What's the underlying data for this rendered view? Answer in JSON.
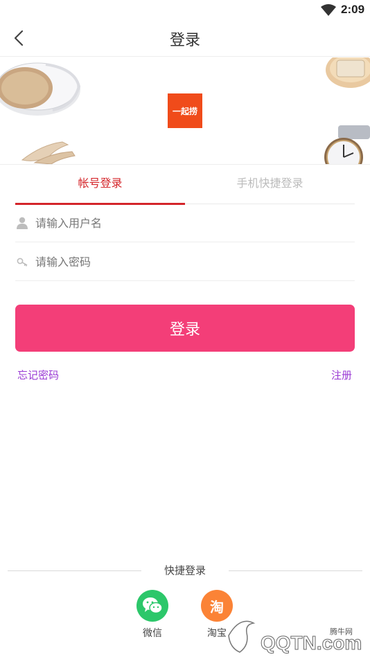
{
  "status_bar": {
    "time": "2:09"
  },
  "header": {
    "title": "登录"
  },
  "banner": {
    "logo_text": "一起捞"
  },
  "tabs": [
    {
      "label": "帐号登录",
      "active": true
    },
    {
      "label": "手机快捷登录",
      "active": false
    }
  ],
  "form": {
    "username_placeholder": "请输入用户名",
    "password_placeholder": "请输入密码",
    "submit_label": "登录"
  },
  "links": {
    "forgot": "忘记密码",
    "register": "注册"
  },
  "quick_login": {
    "title": "快捷登录",
    "providers": [
      {
        "label": "微信",
        "icon": "wechat-icon",
        "color": "#2cc76a"
      },
      {
        "label": "淘宝",
        "icon": "taobao-icon",
        "color": "#fb8336"
      }
    ]
  },
  "watermark": {
    "text": "QQTN.com",
    "site": "腾牛网"
  },
  "colors": {
    "accent": "#f33e78",
    "tab_active": "#d4252a",
    "link": "#9a3ad4"
  }
}
